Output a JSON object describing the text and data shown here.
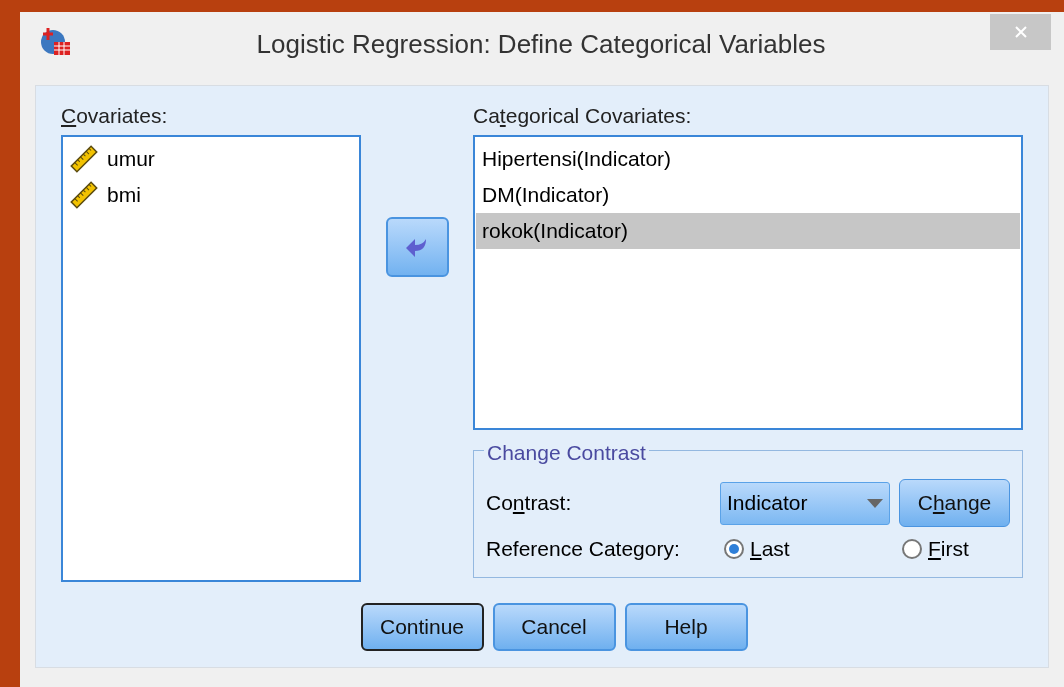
{
  "window": {
    "title": "Logistic Regression: Define Categorical Variables"
  },
  "covariates": {
    "label": {
      "key": "C",
      "post": "ovariates:"
    },
    "items": [
      {
        "name": "umur",
        "selected": false
      },
      {
        "name": "bmi",
        "selected": false
      }
    ]
  },
  "categorical_covariates": {
    "label": {
      "pre": "Ca",
      "key": "t",
      "post": "egorical Covariates:"
    },
    "items": [
      {
        "name": "Hipertensi(Indicator)",
        "selected": false
      },
      {
        "name": "DM(Indicator)",
        "selected": false
      },
      {
        "name": "rokok(Indicator)",
        "selected": true
      }
    ]
  },
  "change_contrast": {
    "title": "Change Contrast",
    "contrast_label": {
      "pre": "Co",
      "key": "n",
      "post": "trast:"
    },
    "contrast_value": "Indicator",
    "change_button": {
      "pre": "C",
      "key": "h",
      "post": "ange"
    },
    "reference_label": "Reference Category:",
    "options": [
      {
        "label": {
          "key": "L",
          "post": "ast"
        },
        "selected": true
      },
      {
        "label": {
          "key": "F",
          "post": "irst"
        },
        "selected": false
      }
    ]
  },
  "buttons": [
    {
      "label": "Continue",
      "default": true
    },
    {
      "label": "Cancel",
      "default": false
    },
    {
      "label": "Help",
      "default": false
    }
  ]
}
